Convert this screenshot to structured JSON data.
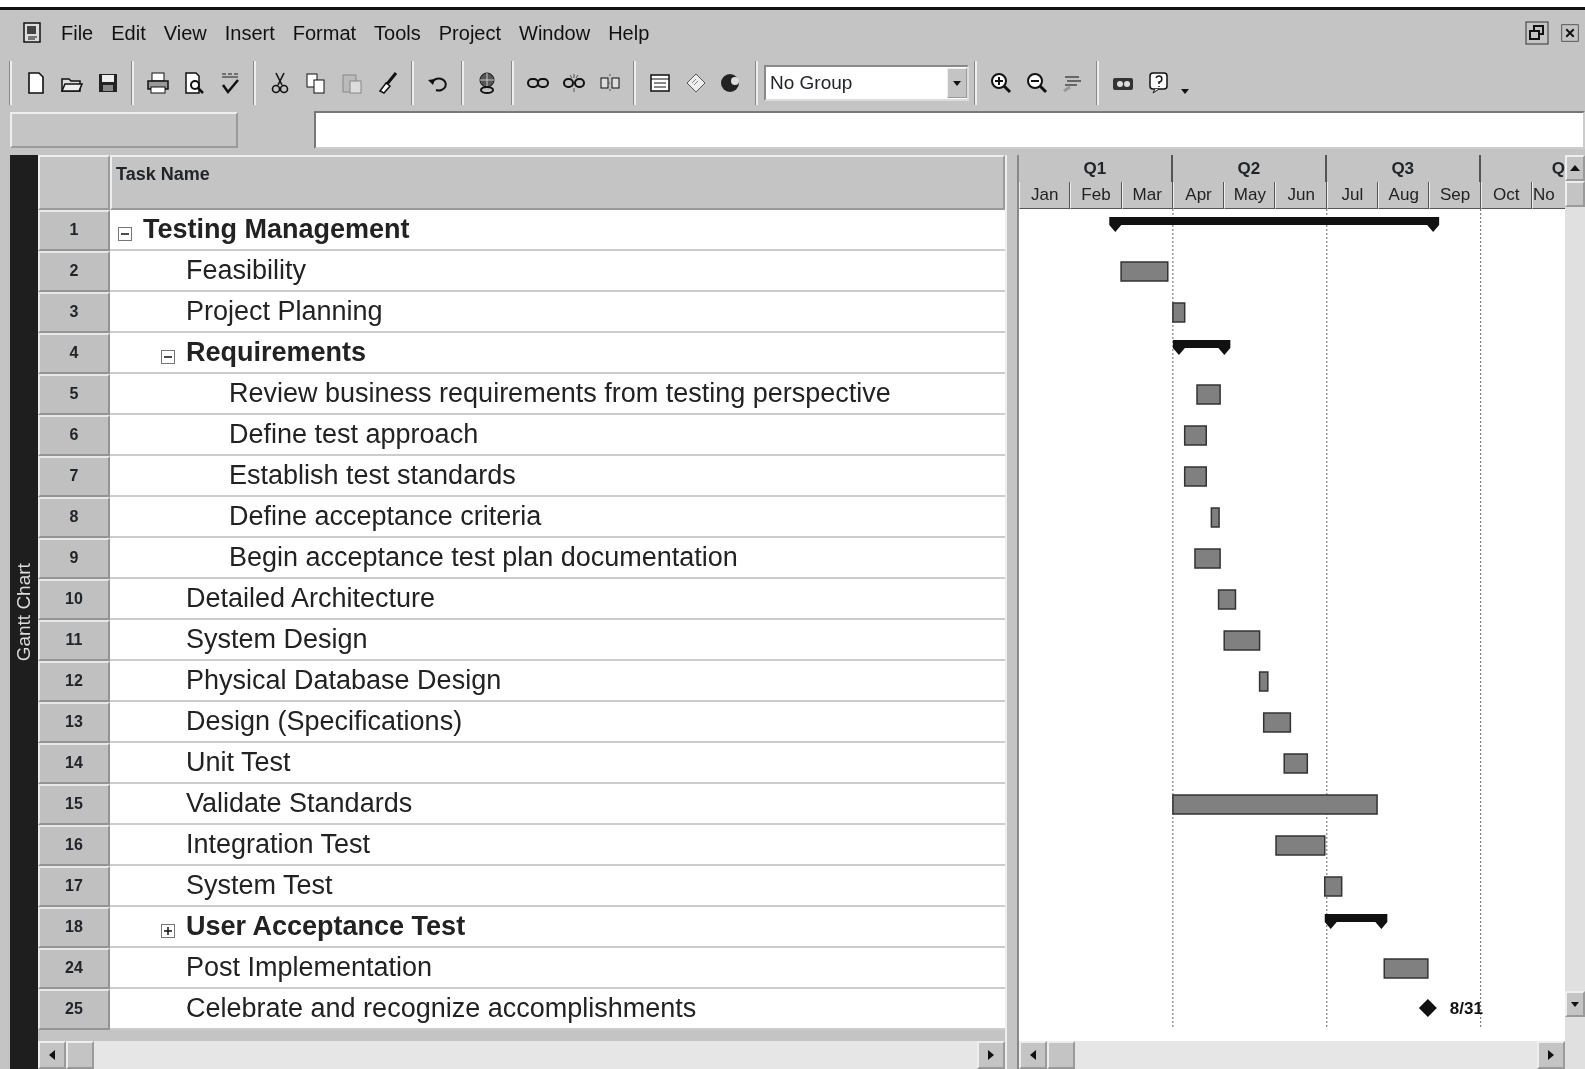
{
  "menu": [
    "File",
    "Edit",
    "View",
    "Insert",
    "Format",
    "Tools",
    "Project",
    "Window",
    "Help"
  ],
  "toolbar": {
    "group_select": "No Group"
  },
  "side_label": "Gantt Chart",
  "table": {
    "columns": [
      "Task Name"
    ],
    "tasks": [
      {
        "id": "1",
        "name": "Testing Management",
        "kind": "summary",
        "expanded": true,
        "children": [
          {
            "id": "2",
            "name": "Feasibility",
            "kind": "task"
          },
          {
            "id": "3",
            "name": "Project Planning",
            "kind": "task"
          },
          {
            "id": "4",
            "name": "Requirements",
            "kind": "summary",
            "expanded": true,
            "children": [
              {
                "id": "5",
                "name": "Review business requirements from testing perspective",
                "kind": "task"
              },
              {
                "id": "6",
                "name": "Define test approach",
                "kind": "task"
              },
              {
                "id": "7",
                "name": "Establish test standards",
                "kind": "task"
              },
              {
                "id": "8",
                "name": "Define acceptance criteria",
                "kind": "task"
              },
              {
                "id": "9",
                "name": "Begin acceptance test plan documentation",
                "kind": "task"
              }
            ]
          },
          {
            "id": "10",
            "name": "Detailed Architecture",
            "kind": "task"
          },
          {
            "id": "11",
            "name": "System Design",
            "kind": "task"
          },
          {
            "id": "12",
            "name": "Physical Database Design",
            "kind": "task"
          },
          {
            "id": "13",
            "name": "Design (Specifications)",
            "kind": "task"
          },
          {
            "id": "14",
            "name": "Unit Test",
            "kind": "task"
          },
          {
            "id": "15",
            "name": "Validate Standards",
            "kind": "task"
          },
          {
            "id": "16",
            "name": "Integration Test",
            "kind": "task"
          },
          {
            "id": "17",
            "name": "System Test",
            "kind": "task"
          },
          {
            "id": "18",
            "name": "User Acceptance Test",
            "kind": "summary",
            "expanded": false
          },
          {
            "id": "24",
            "name": "Post Implementation",
            "kind": "task"
          },
          {
            "id": "25",
            "name": "Celebrate and recognize accomplishments",
            "kind": "milestone",
            "date_label": "8/31"
          }
        ]
      }
    ]
  },
  "timescale": {
    "quarters": [
      "Q1",
      "Q2",
      "Q3",
      "Q"
    ],
    "months": [
      "Jan",
      "Feb",
      "Mar",
      "Apr",
      "May",
      "Jun",
      "Jul",
      "Aug",
      "Sep",
      "Oct",
      "No"
    ]
  }
}
